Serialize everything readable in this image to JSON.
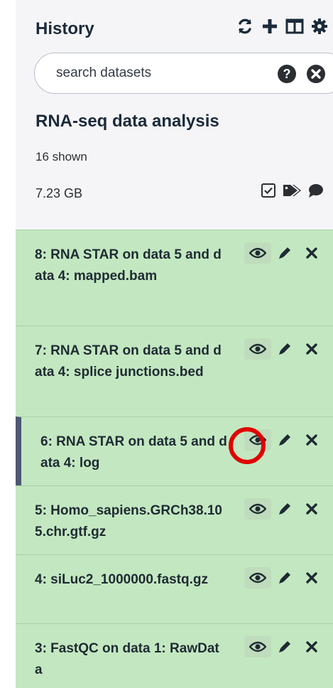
{
  "header": {
    "title": "History",
    "icons": [
      "refresh-icon",
      "plus-icon",
      "columns-icon",
      "gear-icon"
    ]
  },
  "search": {
    "placeholder": "search datasets",
    "icons": [
      "help-icon",
      "clear-icon"
    ]
  },
  "history": {
    "name": "RNA-seq data analysis",
    "shown": "16 shown",
    "size": "7.23 GB",
    "icons": [
      "checkbox-icon",
      "tags-icon",
      "comment-icon"
    ]
  },
  "datasets": [
    {
      "title": "8: RNA STAR on data 5 and data 4: mapped.bam",
      "state_color": "#c3e8c1",
      "active": false
    },
    {
      "title": "7: RNA STAR on data 5 and data 4: splice junctions.bed",
      "state_color": "#c3e8c1",
      "active": false
    },
    {
      "title": "6: RNA STAR on data 5 and data 4: log",
      "state_color": "#c3e8c1",
      "active": true
    },
    {
      "title": "5: Homo_sapiens.GRCh38.105.chr.gtf.gz",
      "state_color": "#c3e8c1",
      "active": false
    },
    {
      "title": "4: siLuc2_1000000.fastq.gz",
      "state_color": "#c3e8c1",
      "active": false
    },
    {
      "title": "3: FastQC on data 1: RawData",
      "state_color": "#c3e8c1",
      "active": false
    }
  ],
  "dataset_actions": [
    "eye-icon",
    "pencil-icon",
    "delete-icon"
  ],
  "colors": {
    "ok_state": "#c3e8c1",
    "active_bar": "#4d5874",
    "highlight": "#e00000"
  }
}
